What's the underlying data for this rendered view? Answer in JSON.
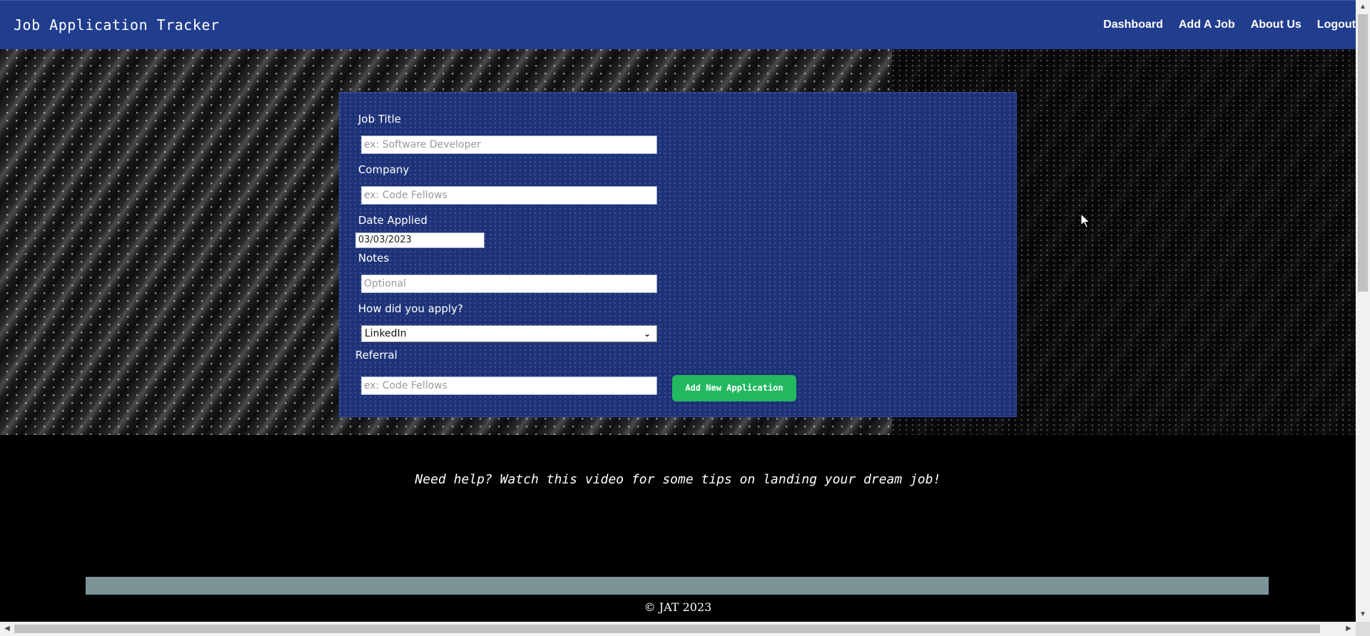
{
  "header": {
    "title": "Job Application Tracker",
    "nav": [
      "Dashboard",
      "Add A Job",
      "About Us",
      "Logout"
    ]
  },
  "form": {
    "job_title_label": "Job Title",
    "job_title_placeholder": "ex: Software Developer",
    "company_label": "Company",
    "company_placeholder": "ex: Code Fellows",
    "date_label": "Date Applied",
    "date_value": "03/03/2023",
    "notes_label": "Notes",
    "notes_placeholder": "Optional",
    "apply_label": "How did you apply?",
    "apply_value": "LinkedIn",
    "referral_label": "Referral",
    "referral_placeholder": "ex: Code Fellows",
    "submit_label": "Add New Application"
  },
  "footer": {
    "tip": "Need help? Watch this video for some tips on landing your dream job!",
    "copyright": "© JAT 2023"
  },
  "colors": {
    "header_bg": "#213d8e",
    "panel_bg": "#1e3377",
    "button_bg": "#22b960",
    "bar_bg": "#7c9398"
  }
}
